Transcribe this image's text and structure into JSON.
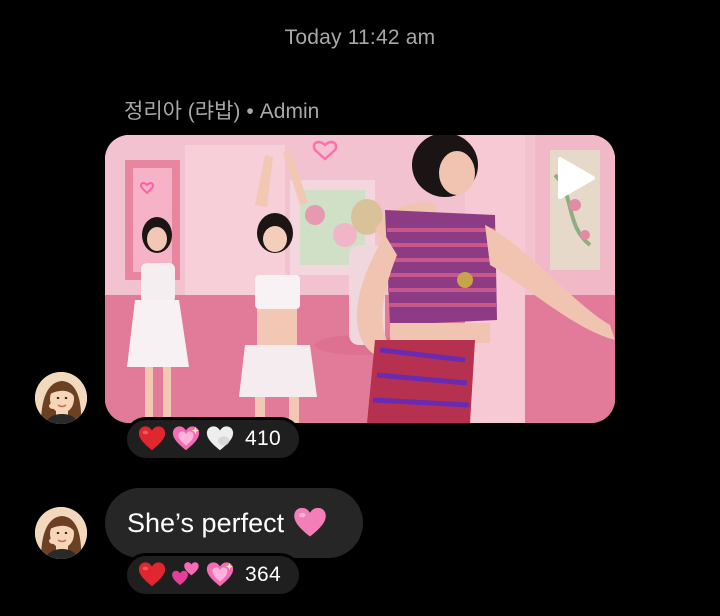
{
  "thread": {
    "timestamp": "Today 11:42 am"
  },
  "messages": [
    {
      "sender_name": "정리아 (랴밥)",
      "separator": "•",
      "sender_role": "Admin",
      "type": "video",
      "media_icon": "play-icon",
      "reactions": {
        "emojis": [
          "red-heart-emoji",
          "sparkling-heart-emoji",
          "white-heart-emoji"
        ],
        "count": "410"
      }
    },
    {
      "type": "text",
      "text": "She’s perfect",
      "text_emoji": "pink-heart-emoji",
      "reactions": {
        "emojis": [
          "red-heart-emoji",
          "two-hearts-emoji",
          "sparkling-heart-emoji"
        ],
        "count": "364"
      }
    }
  ],
  "colors": {
    "background": "#000000",
    "bubble": "#262626",
    "reaction_pill": "#1f1f1f",
    "meta_text": "#a8a8a8",
    "red_heart": "#e0262e",
    "pink_heart": "#f47fb8",
    "white_heart": "#eeeeee"
  }
}
